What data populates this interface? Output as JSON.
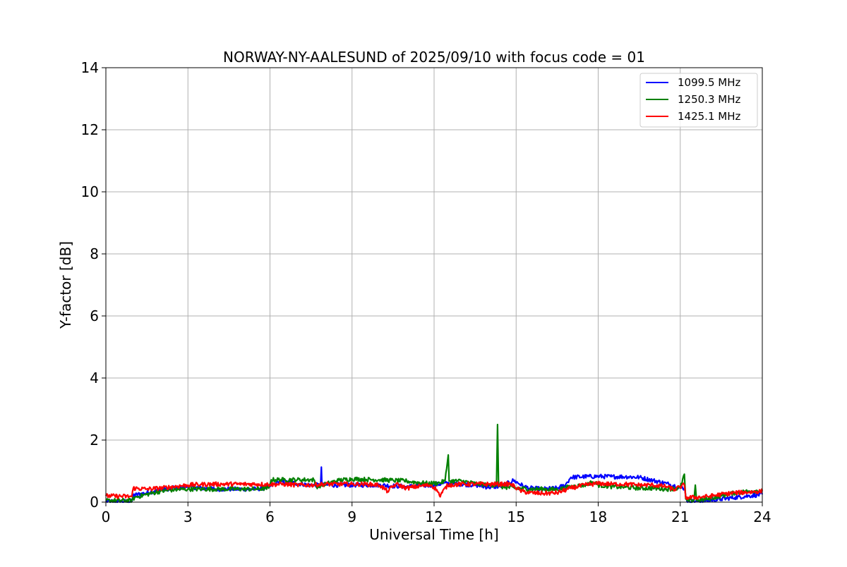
{
  "chart_data": {
    "type": "line",
    "title": "NORWAY-NY-AALESUND of 2025/09/10 with focus code = 01",
    "xlabel": "Universal Time [h]",
    "ylabel": "Y-factor [dB]",
    "xlim": [
      0,
      24
    ],
    "ylim": [
      0,
      14
    ],
    "xticks": [
      0,
      3,
      6,
      9,
      12,
      15,
      18,
      21,
      24
    ],
    "yticks": [
      0,
      2,
      4,
      6,
      8,
      10,
      12,
      14
    ],
    "grid": true,
    "legend_position": "top-right",
    "series": [
      {
        "name": "1099.5 MHz",
        "color": "#0000ff",
        "x": [
          0,
          0.95,
          1.0,
          1.5,
          2.0,
          2.5,
          3.0,
          3.5,
          4.0,
          4.5,
          5.0,
          5.5,
          6.0,
          6.3,
          6.8,
          7.5,
          7.85,
          7.88,
          7.9,
          8.2,
          9.0,
          10.0,
          11.0,
          12.0,
          12.3,
          12.6,
          13.5,
          14.0,
          14.5,
          14.9,
          15.3,
          15.5,
          16.0,
          16.5,
          16.8,
          17.0,
          17.5,
          18.0,
          18.5,
          19.0,
          19.5,
          20.0,
          20.5,
          20.9,
          21.15,
          21.25,
          21.5,
          22.0,
          22.5,
          23.0,
          23.5,
          24.0
        ],
        "y": [
          0.02,
          0.02,
          0.22,
          0.3,
          0.4,
          0.45,
          0.5,
          0.45,
          0.42,
          0.42,
          0.42,
          0.42,
          0.5,
          0.65,
          0.62,
          0.55,
          0.55,
          1.13,
          0.55,
          0.55,
          0.55,
          0.55,
          0.5,
          0.55,
          0.6,
          0.6,
          0.55,
          0.48,
          0.52,
          0.7,
          0.5,
          0.45,
          0.42,
          0.45,
          0.55,
          0.8,
          0.82,
          0.83,
          0.82,
          0.82,
          0.8,
          0.7,
          0.6,
          0.5,
          0.45,
          0.02,
          0.02,
          0.05,
          0.1,
          0.15,
          0.2,
          0.25
        ]
      },
      {
        "name": "1250.3 MHz",
        "color": "#008000",
        "x": [
          0,
          0.95,
          1.05,
          1.5,
          2.0,
          2.5,
          3.0,
          3.5,
          4.0,
          4.5,
          5.0,
          5.5,
          5.95,
          6.05,
          6.5,
          7.0,
          7.6,
          7.7,
          8.5,
          9.0,
          9.5,
          10.0,
          10.5,
          11.0,
          11.2,
          11.8,
          12.2,
          12.4,
          12.52,
          12.55,
          12.6,
          13.0,
          13.5,
          14.0,
          14.28,
          14.32,
          14.36,
          14.6,
          15.0,
          15.5,
          16.0,
          16.5,
          17.0,
          17.5,
          17.8,
          18.0,
          18.5,
          19.0,
          19.5,
          20.0,
          20.5,
          21.0,
          21.15,
          21.2,
          21.25,
          21.5,
          21.55,
          21.6,
          22.0,
          22.5,
          23.0,
          23.5,
          24.0
        ],
        "y": [
          0.05,
          0.05,
          0.15,
          0.25,
          0.35,
          0.4,
          0.42,
          0.42,
          0.42,
          0.42,
          0.42,
          0.42,
          0.45,
          0.72,
          0.72,
          0.72,
          0.72,
          0.5,
          0.7,
          0.75,
          0.73,
          0.72,
          0.7,
          0.68,
          0.65,
          0.6,
          0.62,
          0.68,
          1.52,
          0.68,
          0.68,
          0.68,
          0.6,
          0.55,
          0.55,
          2.5,
          0.5,
          0.48,
          0.45,
          0.42,
          0.42,
          0.4,
          0.5,
          0.55,
          0.65,
          0.55,
          0.5,
          0.48,
          0.45,
          0.45,
          0.42,
          0.45,
          0.9,
          0.1,
          0.05,
          0.05,
          0.55,
          0.05,
          0.1,
          0.2,
          0.3,
          0.35,
          0.38
        ]
      },
      {
        "name": "1425.1 MHz",
        "color": "#ff0000",
        "x": [
          0,
          0.95,
          1.0,
          1.5,
          2.0,
          2.5,
          3.0,
          3.5,
          4.0,
          4.5,
          5.0,
          5.5,
          6.0,
          6.5,
          7.0,
          7.5,
          8.0,
          8.5,
          9.0,
          9.5,
          10.0,
          10.3,
          10.6,
          11.0,
          11.5,
          11.9,
          12.1,
          12.2,
          12.5,
          13.0,
          13.5,
          14.0,
          14.5,
          14.8,
          15.2,
          15.5,
          16.0,
          16.5,
          17.0,
          17.5,
          18.0,
          18.5,
          19.0,
          19.5,
          20.0,
          20.5,
          20.8,
          21.0,
          21.15,
          21.2,
          21.5,
          22.0,
          22.5,
          23.0,
          23.5,
          24.0
        ],
        "y": [
          0.2,
          0.18,
          0.45,
          0.42,
          0.45,
          0.5,
          0.55,
          0.57,
          0.58,
          0.58,
          0.58,
          0.58,
          0.57,
          0.58,
          0.55,
          0.55,
          0.58,
          0.58,
          0.58,
          0.58,
          0.55,
          0.35,
          0.58,
          0.45,
          0.52,
          0.55,
          0.4,
          0.2,
          0.55,
          0.58,
          0.58,
          0.58,
          0.58,
          0.58,
          0.35,
          0.3,
          0.28,
          0.3,
          0.45,
          0.55,
          0.6,
          0.58,
          0.58,
          0.55,
          0.55,
          0.5,
          0.4,
          0.5,
          0.55,
          0.15,
          0.15,
          0.18,
          0.25,
          0.3,
          0.32,
          0.35
        ]
      }
    ]
  }
}
